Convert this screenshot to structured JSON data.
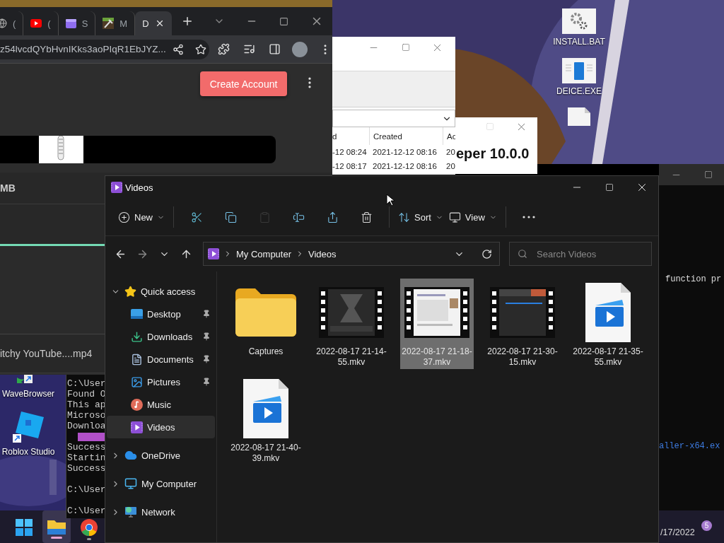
{
  "desktop_icons_right": [
    {
      "kind": "gears",
      "label": "INSTALL.BAT"
    },
    {
      "kind": "app",
      "label": "DEICE.EXE"
    },
    {
      "kind": "file"
    }
  ],
  "desktop_icons_left": [
    {
      "kind": "wave",
      "label": "WaveBrowser"
    },
    {
      "kind": "roblox",
      "label": "Roblox Studio"
    }
  ],
  "browser": {
    "tabs": [
      {
        "kind": "globe",
        "label": "(",
        "selected": false
      },
      {
        "kind": "youtube",
        "label": "(",
        "selected": false
      },
      {
        "kind": "video",
        "label": "S",
        "selected": false
      },
      {
        "kind": "game",
        "label": "M",
        "selected": false
      },
      {
        "kind": "none",
        "label": "D",
        "selected": true
      }
    ],
    "url": "z54lvcdQYbHvnIKks3aoPIqR1EbJYZ...",
    "button": "Create Account",
    "size_label": "MB",
    "file_name": "itchy YouTube....mp4"
  },
  "table_window": {
    "columns": [
      "d",
      "Created",
      "Ac"
    ],
    "rows": [
      [
        "-12 08:24",
        "2021-12-12 08:16",
        "20"
      ],
      [
        "-12 08:17",
        "2021-12-12 08:16",
        "20"
      ]
    ]
  },
  "dialog": {
    "heading": "eper 10.0.0"
  },
  "terminal_right": {
    "lines": [
      {
        "kind": "text",
        "text": "function pr"
      },
      {
        "kind": "link",
        "text": "aller-x64.ex"
      }
    ]
  },
  "terminal_left": {
    "lines": [
      {
        "kind": "text",
        "text": "C:\\User"
      },
      {
        "kind": "text",
        "text": "Found O"
      },
      {
        "kind": "text",
        "text": "This ap"
      },
      {
        "kind": "text",
        "text": "Microso"
      },
      {
        "kind": "text",
        "text": "Downloa"
      },
      {
        "kind": "bar"
      },
      {
        "kind": "text",
        "text": "Success"
      },
      {
        "kind": "text",
        "text": "Startin"
      },
      {
        "kind": "text",
        "text": "Success"
      },
      {
        "kind": "blank"
      },
      {
        "kind": "text",
        "text": "C:\\User"
      },
      {
        "kind": "blank"
      },
      {
        "kind": "text",
        "text": "C:\\User"
      }
    ]
  },
  "taskbar": {
    "apps": [
      {
        "kind": "start",
        "active": false
      },
      {
        "kind": "explorer",
        "active": true
      },
      {
        "kind": "chrome",
        "active": false
      }
    ],
    "date": "/17/2022",
    "badge": "5"
  },
  "explorer": {
    "title": "Videos",
    "toolbar": [
      {
        "kind": "new",
        "label": "New",
        "disabled": false
      },
      {
        "kind": "cut",
        "disabled": false
      },
      {
        "kind": "copy",
        "disabled": false
      },
      {
        "kind": "paste",
        "disabled": true
      },
      {
        "kind": "rename",
        "disabled": false
      },
      {
        "kind": "share",
        "disabled": false
      },
      {
        "kind": "delete",
        "disabled": false
      },
      {
        "kind": "sort",
        "label": "Sort",
        "disabled": false
      },
      {
        "kind": "view",
        "label": "View",
        "disabled": false
      },
      {
        "kind": "more",
        "disabled": false
      }
    ],
    "breadcrumb": [
      "My Computer",
      "Videos"
    ],
    "search": {
      "placeholder": "Search Videos"
    },
    "sidebar": [
      {
        "label": "Quick access",
        "kind": "star",
        "expanded": true,
        "selected": false,
        "children": [
          {
            "label": "Desktop",
            "kind": "desktop",
            "pinned": true,
            "selected": false
          },
          {
            "label": "Downloads",
            "kind": "downloads",
            "pinned": true,
            "selected": false
          },
          {
            "label": "Documents",
            "kind": "documents",
            "pinned": true,
            "selected": false
          },
          {
            "label": "Pictures",
            "kind": "pictures",
            "pinned": true,
            "selected": false
          },
          {
            "label": "Music",
            "kind": "music",
            "pinned": false,
            "selected": false
          },
          {
            "label": "Videos",
            "kind": "videos",
            "pinned": false,
            "selected": true
          }
        ]
      },
      {
        "label": "OneDrive",
        "kind": "cloud",
        "expanded": false,
        "selected": false
      },
      {
        "label": "My Computer",
        "kind": "computer",
        "expanded": false,
        "selected": false
      },
      {
        "label": "Network",
        "kind": "network",
        "expanded": false,
        "selected": false
      }
    ],
    "files": [
      {
        "name": "Captures",
        "kind": "folder",
        "selected": false
      },
      {
        "name": "2022-08-17 21-14-55.mkv",
        "kind": "dark-video",
        "selected": false
      },
      {
        "name": "2022-08-17 21-18-37.mkv",
        "kind": "light-video",
        "selected": true
      },
      {
        "name": "2022-08-17 21-30-15.mkv",
        "kind": "app-video",
        "selected": false
      },
      {
        "name": "2022-08-17 21-35-55.mkv",
        "kind": "video-file",
        "selected": false
      },
      {
        "name": "2022-08-17 21-40-39.mkv",
        "kind": "video-file",
        "selected": false
      }
    ]
  }
}
